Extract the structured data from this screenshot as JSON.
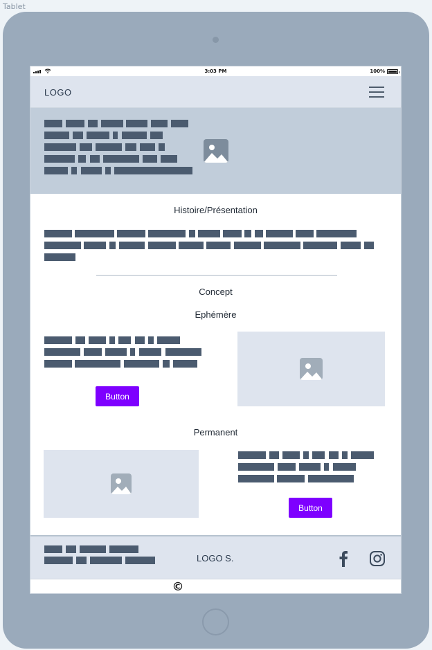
{
  "frame": {
    "label": "Tablet"
  },
  "statusbar": {
    "time": "3:03 PM",
    "battery": "100%"
  },
  "navbar": {
    "logo": "LOGO",
    "menu_icon": "hamburger-menu-icon"
  },
  "hero": {
    "image_icon": "image-placeholder-icon"
  },
  "sections": {
    "histoire_title": "Histoire/Présentation",
    "concept_title": "Concept",
    "ephemere_title": "Ephémère",
    "ephemere_button": "Button",
    "permanent_title": "Permanent",
    "permanent_button": "Button"
  },
  "footer": {
    "logo": "LOGO S.",
    "social": [
      "facebook-icon",
      "instagram-icon"
    ],
    "copyright": "©"
  },
  "colors": {
    "accent": "#7e00ff",
    "text_block": "#4b5b6f",
    "hero_bg": "#c1cdda",
    "nav_bg": "#dee4ee",
    "device": "#9aaabb"
  }
}
